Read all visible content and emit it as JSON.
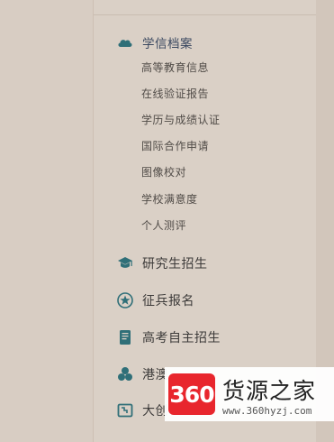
{
  "nav": {
    "sections": [
      {
        "label": "学信档案",
        "icon": "cloud-icon",
        "active": true,
        "items": [
          "高等教育信息",
          "在线验证报告",
          "学历与成绩认证",
          "国际合作申请",
          "图像校对",
          "学校满意度",
          "个人测评"
        ]
      },
      {
        "label": "研究生招生",
        "icon": "graduation-cap-icon"
      },
      {
        "label": "征兵报名",
        "icon": "star-badge-icon"
      },
      {
        "label": "高考自主招生",
        "icon": "scroll-icon"
      },
      {
        "label": "港澳",
        "icon": "cluster-icon"
      },
      {
        "label": "大创",
        "icon": "board-icon"
      }
    ]
  },
  "watermark": {
    "logo_text": "360",
    "title": "货源之家",
    "url": "www.360hyzj.com"
  },
  "colors": {
    "panel_bg": "#dad0c6",
    "icon_teal": "#2f6f78",
    "active_label": "#3a4860",
    "logo_red": "#e8262d"
  }
}
